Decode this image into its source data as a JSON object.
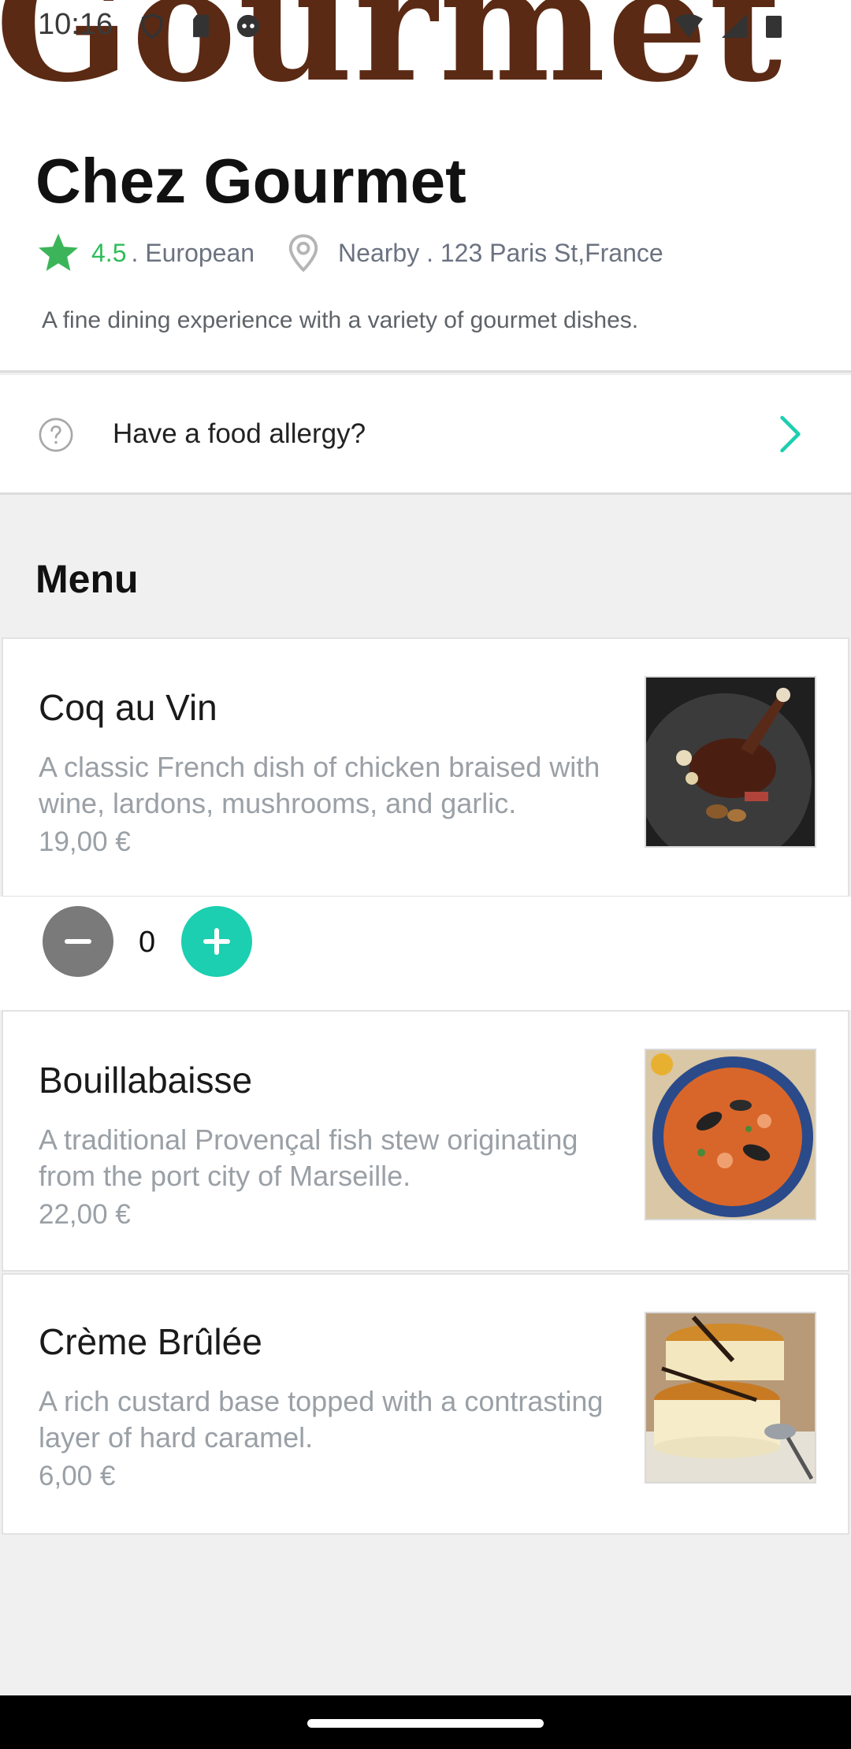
{
  "status_bar": {
    "time": "10:16",
    "icons_left": [
      "shield-icon",
      "sd-card-icon",
      "face-icon"
    ],
    "icons_right": [
      "wifi-icon",
      "signal-icon",
      "battery-icon"
    ]
  },
  "banner": {
    "logo_text": "Gourmet"
  },
  "restaurant": {
    "name": "Chez Gourmet",
    "rating": "4.5",
    "cuisine": ". European",
    "location": "Nearby . 123 Paris St,France",
    "description": "A fine dining experience with a variety of gourmet dishes."
  },
  "allergy": {
    "label": "Have a food allergy?"
  },
  "menu": {
    "title": "Menu",
    "items": [
      {
        "name": "Coq au Vin",
        "description": "A classic French dish of chicken braised with wine, lardons, mushrooms, and garlic.",
        "price": "19,00 €",
        "quantity": "0"
      },
      {
        "name": " Bouillabaisse",
        "description": "A traditional Provençal fish stew originating from the port city of Marseille.",
        "price": "22,00 €"
      },
      {
        "name": "Crème Brûlée",
        "description": " A rich custard base topped with a contrasting layer of hard caramel.",
        "price": "6,00 €"
      }
    ]
  },
  "colors": {
    "accent": "#1ccfb0",
    "rating_green": "#2dbd5a",
    "muted_text": "#9aa0a6",
    "decrement_button": "#7a7a7a"
  }
}
